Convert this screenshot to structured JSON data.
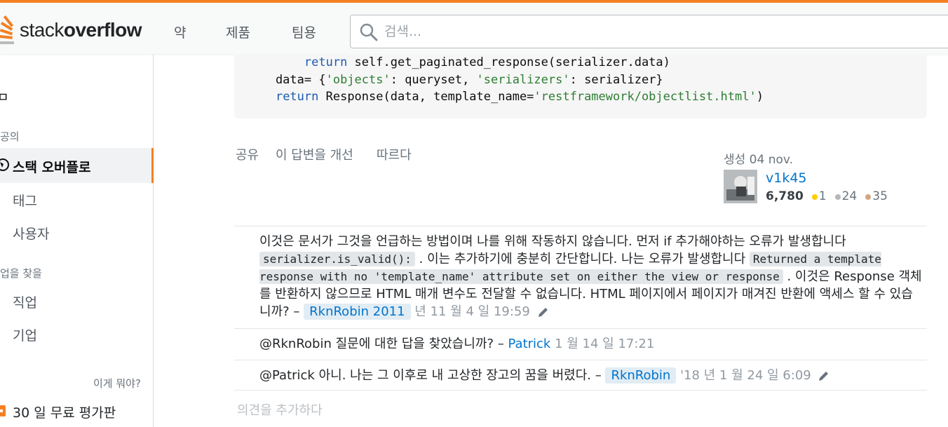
{
  "brand": {
    "logo_text_regular": "stack",
    "logo_text_bold": "overflow"
  },
  "nav": {
    "item1": "약",
    "item2": "제품",
    "item3": "팀용"
  },
  "search": {
    "placeholder": "검색..."
  },
  "sidebar": {
    "partial_top": "ㅁ",
    "section_public": "공의",
    "active_item": "스택 오버플로",
    "tags": "태그",
    "users": "사용자",
    "section_jobs": "업을 찾을",
    "jobs": "직업",
    "companies": "기업",
    "what_is_this": "이게 뭐야?",
    "trial": "30 일 무료 평가판"
  },
  "code": {
    "line1": {
      "indent": "        ",
      "kw": "return",
      "rest": " self.get_paginated_response(serializer.data)"
    },
    "line2": {
      "pre": "    data= {",
      "s1": "'objects'",
      "mid": ": queryset, ",
      "s2": "'serializers'",
      "post": ": serializer}"
    },
    "line3": {
      "indent": "    ",
      "kw": "return",
      "pre": " Response(data, template_name=",
      "s": "'restframework/objectlist.html'",
      "post": ")"
    }
  },
  "post_menu": {
    "share": "공유",
    "improve": "이 답변을 개선",
    "follow": "따르다"
  },
  "user_card": {
    "action": "생성 04 nov.",
    "name": "v1k45",
    "reputation": "6,780",
    "gold": "1",
    "silver": "24",
    "bronze": "35",
    "colors": {
      "gold": "#ffcc01",
      "silver": "#b4b8bc",
      "bronze": "#d1a684"
    }
  },
  "comments": [
    {
      "text_a": "이것은 문서가 그것을 언급하는 방법이며 나를 위해 작동하지 않습니다. 먼저 if 추가해야하는 오류가 발생합니다",
      "code_a": "serializer.is_valid():",
      "text_b": ". 이는 추가하기에 충분히 간단합니다. 나는 오류가 발생합니다",
      "code_b": "Returned a template response with no 'template_name' attribute set on either the view or response",
      "text_c": ". 이것은 Response 객체를 반환하지 않으므로 HTML 매개 변수도 전달할 수 없습니다. HTML 페이지에서 페이지가 매겨진 반환에 액세스 할 수 있습니까? –",
      "user": "RknRobin 2011",
      "date": "년 11 월 4 일 19:59"
    },
    {
      "text": "@RknRobin 질문에 대한 답을 찾았습니까? –",
      "user": "Patrick",
      "date": "1 월 14 일 17:21"
    },
    {
      "text": "@Patrick 아니. 나는 그 이후로 내 고상한 장고의 꿈을 버렸다. –",
      "user": "RknRobin",
      "date": "'18 년 1 월 24 일 6:09"
    }
  ],
  "add_comment": "의견을 추가하다"
}
